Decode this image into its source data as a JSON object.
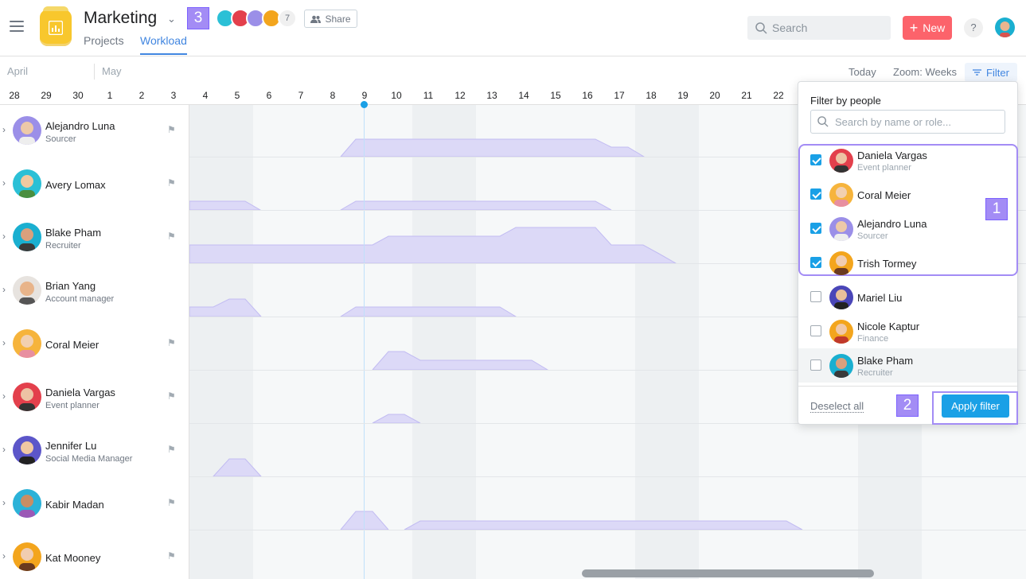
{
  "header": {
    "project_title": "Marketing",
    "tabs": [
      {
        "label": "Projects"
      },
      {
        "label": "Workload"
      }
    ],
    "member_count": "7",
    "share_label": "Share",
    "search_placeholder": "Search",
    "new_label": "New",
    "help_label": "?"
  },
  "markers": {
    "one": "1",
    "two": "2",
    "three": "3"
  },
  "timeline": {
    "months": [
      "April",
      "May"
    ],
    "days": [
      "28",
      "29",
      "30",
      "1",
      "2",
      "3",
      "4",
      "5",
      "6",
      "7",
      "8",
      "9",
      "10",
      "11",
      "12",
      "13",
      "14",
      "15",
      "16",
      "17",
      "18",
      "19",
      "20",
      "21",
      "22"
    ],
    "today_label": "Today",
    "zoom_label": "Zoom: Weeks",
    "filter_label": "Filter"
  },
  "people": [
    {
      "name": "Alejandro Luna",
      "role": "Sourcer",
      "color": "#9b8fe8"
    },
    {
      "name": "Avery Lomax",
      "role": "",
      "color": "#2bc0d6"
    },
    {
      "name": "Blake Pham",
      "role": "Recruiter",
      "color": "#1aafd0"
    },
    {
      "name": "Brian Yang",
      "role": "Account manager",
      "color": "#e7e3df"
    },
    {
      "name": "Coral Meier",
      "role": "",
      "color": "#f6b43c"
    },
    {
      "name": "Daniela Vargas",
      "role": "Event planner",
      "color": "#e3404c"
    },
    {
      "name": "Jennifer Lu",
      "role": "Social Media Manager",
      "color": "#5c56c9"
    },
    {
      "name": "Kabir Madan",
      "role": "",
      "color": "#2bb2d8"
    },
    {
      "name": "Kat Mooney",
      "role": "",
      "color": "#f3a51d"
    }
  ],
  "filter_panel": {
    "title": "Filter by people",
    "search_placeholder": "Search by name or role...",
    "items": [
      {
        "name": "Daniela Vargas",
        "role": "Event planner",
        "checked": true,
        "color": "#e3404c"
      },
      {
        "name": "Coral Meier",
        "role": "",
        "checked": true,
        "color": "#f6b43c"
      },
      {
        "name": "Alejandro Luna",
        "role": "Sourcer",
        "checked": true,
        "color": "#9b8fe8"
      },
      {
        "name": "Trish Tormey",
        "role": "",
        "checked": true,
        "color": "#f3a51d"
      },
      {
        "name": "Mariel Liu",
        "role": "",
        "checked": false,
        "color": "#4a46b8"
      },
      {
        "name": "Nicole Kaptur",
        "role": "Finance",
        "checked": false,
        "color": "#f3a51d"
      },
      {
        "name": "Blake Pham",
        "role": "Recruiter",
        "checked": false,
        "color": "#1aafd0"
      }
    ],
    "deselect_label": "Deselect all",
    "apply_label": "Apply filter"
  },
  "colors": {
    "accent": "#4186e0",
    "new_button": "#fc636b",
    "workload_fill": "#dcd9f7",
    "marker": "#a38cf5",
    "apply": "#1aa0e6"
  }
}
